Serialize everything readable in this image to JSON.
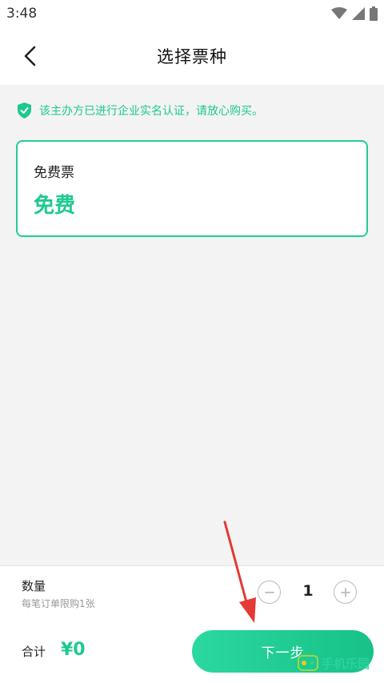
{
  "status_bar": {
    "time": "3:48"
  },
  "header": {
    "title": "选择票种",
    "back_icon": "chevron-left-icon"
  },
  "notice": {
    "text": "该主办方已进行企业实名认证，请放心购买。",
    "icon": "shield-check-icon",
    "color": "#1ec98f"
  },
  "ticket": {
    "name": "免费票",
    "price": "免费",
    "border_color": "#24cc93"
  },
  "footer": {
    "quantity_label": "数量",
    "quantity_limit": "每笔订单限购1张",
    "quantity_value": "1",
    "total_label": "合计",
    "total_value": "¥0",
    "next_button": "下一步"
  },
  "annotations": {
    "arrow_color": "#e53935"
  },
  "watermark": {
    "text": "手机乐园"
  },
  "colors": {
    "accent": "#1ec98f",
    "background": "#f3f3f3"
  }
}
